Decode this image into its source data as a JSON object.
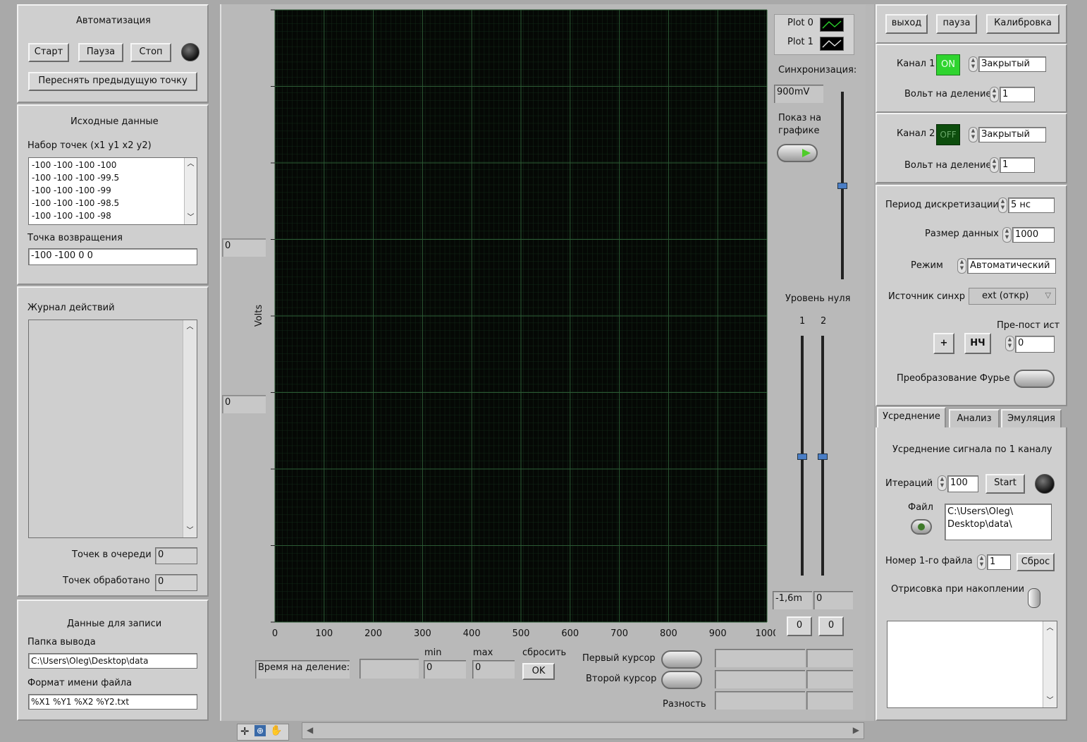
{
  "automation": {
    "title": "Автоматизация",
    "start": "Старт",
    "pause": "Пауза",
    "stop": "Стоп",
    "resend": "Переснять предыдущую точку"
  },
  "source": {
    "title": "Исходные данные",
    "points_label": "Набор точек (x1 y1 x2 y2)",
    "points": [
      "-100 -100 -100 -100",
      "-100 -100 -100 -99.5",
      "-100 -100 -100 -99",
      "-100 -100 -100 -98.5",
      "-100 -100 -100 -98"
    ],
    "return_label": "Точка возвращения",
    "return_value": "-100 -100 0 0"
  },
  "log": {
    "title": "Журнал действий",
    "queue_label": "Точек в очереди",
    "queue_value": "0",
    "processed_label": "Точек обработано",
    "processed_value": "0"
  },
  "record": {
    "title": "Данные для записи",
    "folder_label": "Папка вывода",
    "folder_value": "C:\\Users\\Oleg\\Desktop\\data",
    "format_label": "Формат имени файла",
    "format_value": "%X1 %Y1 %X2 %Y2.txt"
  },
  "chart": {
    "ylabel": "Volts",
    "y_scale_top": "0",
    "y_scale_bottom": "0",
    "x_ticks": [
      "0",
      "100",
      "200",
      "300",
      "400",
      "500",
      "600",
      "700",
      "800",
      "900",
      "1000"
    ],
    "plot0": "Plot 0",
    "plot1": "Plot 1",
    "sync_label": "Синхронизация:",
    "sync_value": "900mV",
    "show_label_1": "Показ на",
    "show_label_2": "графике",
    "zero_label": "Уровень нуля",
    "zero_ch1": "1",
    "zero_ch2": "2",
    "zero_val1": "-1,6m",
    "zero_val2": "0",
    "btn0a": "0",
    "btn0b": "0",
    "time_div_label": "Время на деление:",
    "min_label": "min",
    "max_label": "max",
    "min_value": "0",
    "max_value": "0",
    "reset_label": "сбросить",
    "ok": "OK",
    "cursor1": "Первый курсор",
    "cursor2": "Второй курсор",
    "diff": "Разность"
  },
  "top": {
    "exit": "выход",
    "pause": "пауза",
    "calib": "Калибровка"
  },
  "ch1": {
    "label": "Канал 1",
    "state": "ON",
    "coupling": "Закрытый",
    "vdiv_label": "Вольт на деление",
    "vdiv": "1"
  },
  "ch2": {
    "label": "Канал 2",
    "state": "OFF",
    "coupling": "Закрытый",
    "vdiv_label": "Вольт на деление",
    "vdiv": "1"
  },
  "acq": {
    "period_label": "Период дискретизации",
    "period": "5 нс",
    "size_label": "Размер данных",
    "size": "1000",
    "mode_label": "Режим",
    "mode": "Автоматический",
    "trig_label": "Источник синхр",
    "trig": "ext (откр)",
    "prepost_label": "Пре-пост ист",
    "plus": "+",
    "lf": "НЧ",
    "prepost": "0",
    "fft_label": "Преобразование Фурье"
  },
  "tabs": [
    "Усреднение",
    "Анализ",
    "Эмуляция"
  ],
  "avg": {
    "title": "Усреднение сигнала по 1 каналу",
    "iter_label": "Итераций",
    "iter": "100",
    "start": "Start",
    "file_label": "Файл",
    "file_path": "C:\\Users\\Oleg\\\nDesktop\\data\\",
    "first_label": "Номер 1-го файла",
    "first": "1",
    "reset": "Сброс",
    "draw_label": "Отрисовка при накоплении"
  }
}
